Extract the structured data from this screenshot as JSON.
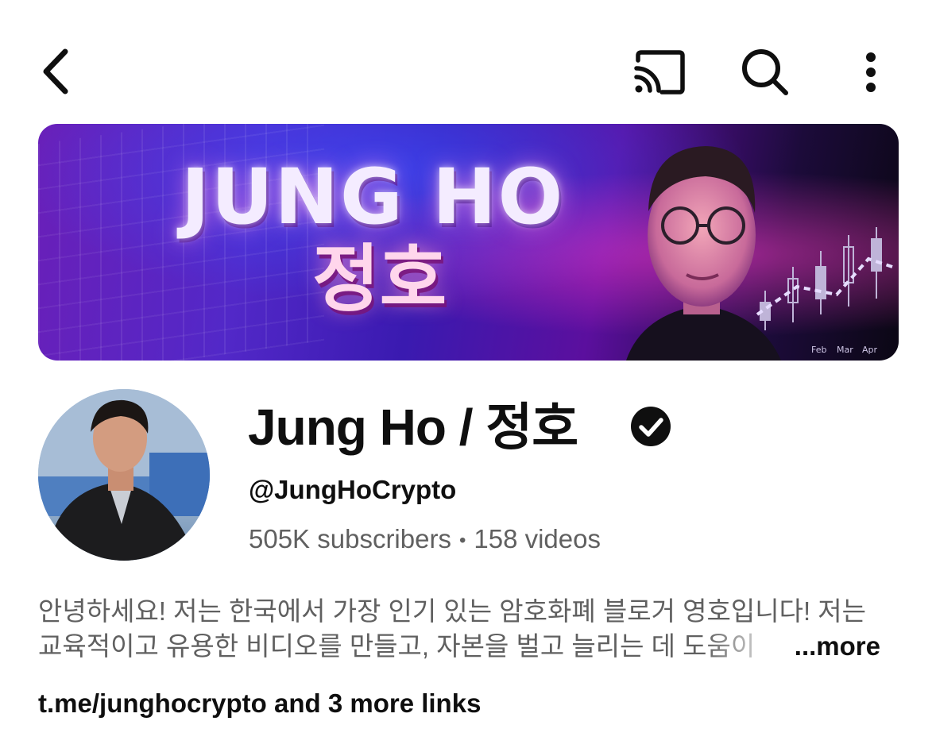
{
  "topbar": {
    "back_icon": "chevron-left-icon",
    "cast_icon": "cast-icon",
    "search_icon": "search-icon",
    "menu_icon": "more-vert-icon"
  },
  "banner": {
    "title": "JUNG HO",
    "subtitle": "정호",
    "chart_months": [
      "Feb",
      "Mar",
      "Apr"
    ],
    "accent_colors": [
      "#6a1fb8",
      "#3a1ab0",
      "#ff3cc8"
    ]
  },
  "channel": {
    "name": "Jung Ho / 정호",
    "verified": true,
    "handle": "@JungHoCrypto",
    "subscribers": "505K subscribers",
    "separator": "•",
    "videos": "158 videos"
  },
  "description": {
    "line1": "안녕하세요! 저는 한국에서 가장 인기 있는 암호화폐 블로거 영호입니다! 저는",
    "line2": "교육적이고 유용한 비디오를 만들고, 자본을 벌고 늘리는 데 도움이",
    "more_label": "...more"
  },
  "links": {
    "text": "t.me/junghocrypto and 3 more links"
  }
}
